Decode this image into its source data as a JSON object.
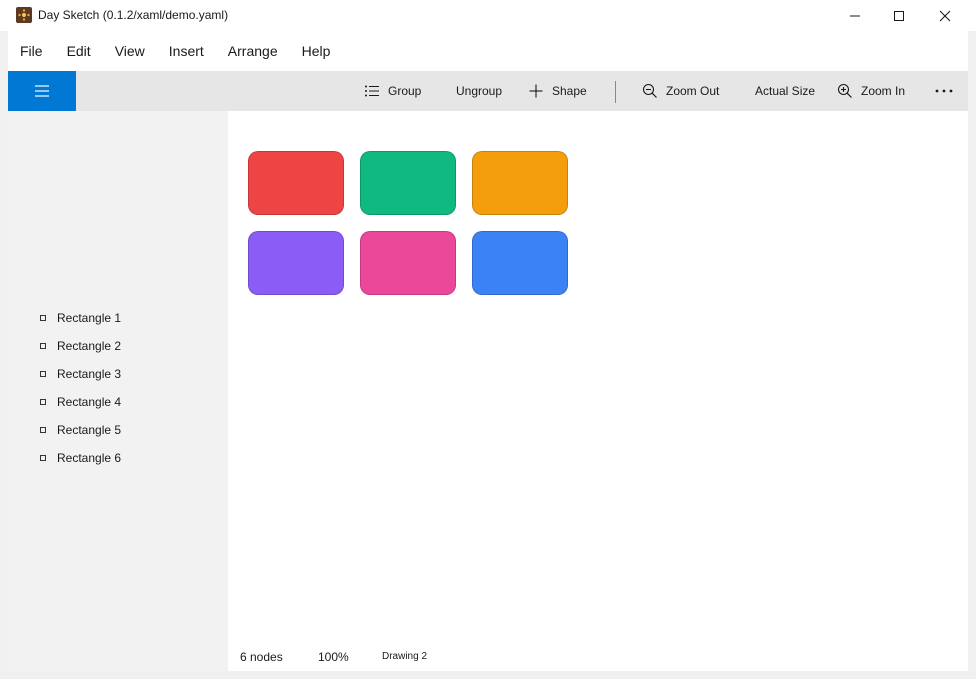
{
  "window": {
    "title": "Day Sketch (0.1.2/xaml/demo.yaml)",
    "app_icon": "day-sketch-icon",
    "controls": [
      "minimize-icon",
      "maximize-icon",
      "close-icon"
    ]
  },
  "menu": {
    "items": [
      {
        "label": "File"
      },
      {
        "label": "Edit"
      },
      {
        "label": "View"
      },
      {
        "label": "Insert"
      },
      {
        "label": "Arrange"
      },
      {
        "label": "Help"
      }
    ]
  },
  "toolbar": {
    "hamburger_icon": "hamburger-icon",
    "accent": "#0078d4",
    "group_label": "Group",
    "ungroup_label": "Ungroup",
    "shape_label": "Shape",
    "zoom_out_label": "Zoom Out",
    "actual_size_label": "Actual Size",
    "zoom_in_label": "Zoom In",
    "more_icon": "more-icon"
  },
  "layers": {
    "items": [
      {
        "label": "Rectangle 1"
      },
      {
        "label": "Rectangle 2"
      },
      {
        "label": "Rectangle 3"
      },
      {
        "label": "Rectangle 4"
      },
      {
        "label": "Rectangle 5"
      },
      {
        "label": "Rectangle 6"
      }
    ]
  },
  "canvas": {
    "shapes": [
      {
        "color": "#ef4444"
      },
      {
        "color": "#10b981"
      },
      {
        "color": "#f59e0b"
      },
      {
        "color": "#8b5cf6"
      },
      {
        "color": "#ec4899"
      },
      {
        "color": "#3b82f6"
      }
    ]
  },
  "status": {
    "nodes": "6 nodes",
    "zoom": "100%",
    "drawing": "Drawing 2"
  }
}
